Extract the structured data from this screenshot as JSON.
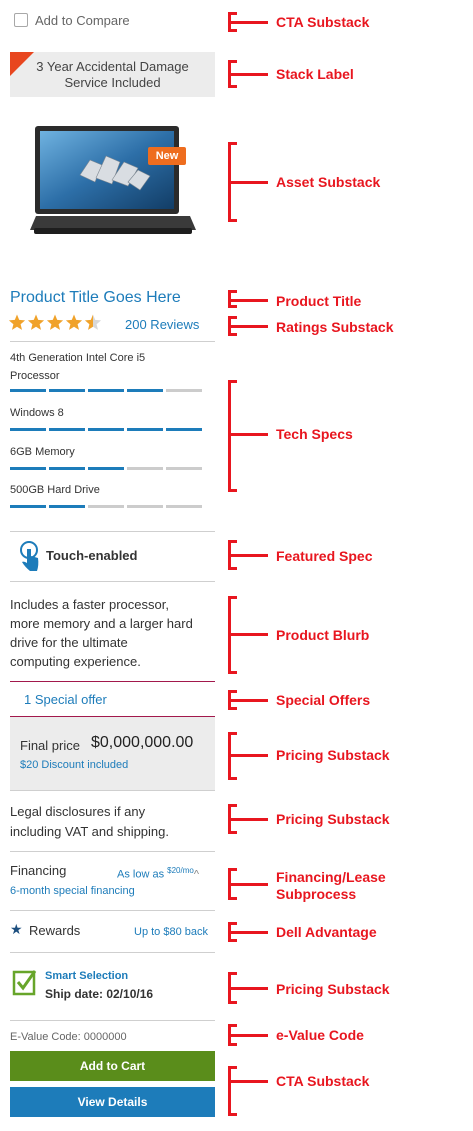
{
  "compare": {
    "label": "Add to Compare"
  },
  "stack_label": {
    "line1": "3 Year Accidental Damage",
    "line2": "Service Included"
  },
  "asset": {
    "badge": "New"
  },
  "product": {
    "title": "Product Title Goes Here",
    "rating": 4.5,
    "reviews": "200 Reviews"
  },
  "specs": [
    {
      "line1": "4th Generation Intel Core i5",
      "line2": "Processor",
      "level": 4
    },
    {
      "line1": "Windows 8",
      "line2": "",
      "level": 5
    },
    {
      "line1": "6GB Memory",
      "line2": "",
      "level": 3
    },
    {
      "line1": "500GB Hard Drive",
      "line2": "",
      "level": 2
    }
  ],
  "featured": {
    "label": "Touch-enabled"
  },
  "blurb": [
    "Includes a faster processor,",
    "more memory and a larger hard",
    "drive for the ultimate",
    "computing experience."
  ],
  "special_offer": "1 Special offer",
  "pricing": {
    "label": "Final price",
    "price": "$0,000,000.00",
    "discount": "$20 Discount included"
  },
  "legal": [
    "Legal disclosures if any",
    "including VAT and shipping."
  ],
  "financing": {
    "label": "Financing",
    "as_low": "As low as ",
    "amount": "$20/mo",
    "caret": "^",
    "special": "6-month special financing"
  },
  "rewards": {
    "label": "Rewards",
    "value": "Up to $80 back"
  },
  "smart": {
    "title": "Smart Selection",
    "ship": "Ship date: 02/10/16"
  },
  "evalue": "E-Value Code: 0000000",
  "buttons": {
    "cart": "Add to Cart",
    "details": "View Details"
  },
  "annotations": [
    "CTA Substack",
    "Stack Label",
    "Asset Substack",
    "Product Title",
    "Ratings Substack",
    "Tech Specs",
    "Featured Spec",
    "Product Blurb",
    "Special Offers",
    "Pricing Substack",
    "Pricing Substack",
    "Financing/Lease",
    "Subprocess",
    "Dell Advantage",
    "Pricing Substack",
    "e-Value Code",
    "CTA Substack"
  ],
  "colors": {
    "accent_blue": "#1d7cba",
    "green": "#5a8d1b",
    "button_blue": "#1d7cba",
    "annotation_red": "#e8161f",
    "magenta_rule": "#a2184c"
  }
}
